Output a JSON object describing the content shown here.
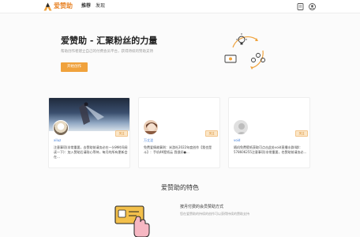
{
  "header": {
    "brand": "爱赞助",
    "nav": [
      "推荐",
      "发现"
    ],
    "icons": [
      "logo-icon",
      "notes-icon",
      "user-icon"
    ],
    "accent": "#f0a23c"
  },
  "hero": {
    "title": "爱赞助 - 汇聚粉丝的力量",
    "subtitle": "帮助创作者建立自己的付费会员平台，获得持续的赞助支持",
    "button": "开始创作"
  },
  "cards": [
    {
      "name": "xiluz",
      "follow": "关注",
      "desc": "注意事项(非常重要，去赞助前请务必在一分钟时间阅读一下)：加入赞助后请耐心等待，每月的所有更新会在…"
    },
    {
      "name": "万丈泷",
      "follow": "关注",
      "desc": "免费爱情故事则：米游社2022年度创作【我也是斗】：手机4K壁纸云 我很好●..."
    },
    {
      "name": "void",
      "follow": "关注",
      "desc": "随机免费壁纸获取可点击此处void直播水群4群：578606255注意事项(非常重要，也赞助前请务必..."
    }
  ],
  "features": {
    "title": "爱赞助的特色",
    "items": [
      {
        "heading": "按月付费的会员赞助方式",
        "desc": "您在爱赞助的持续的创作可以获得持续的赞助支持"
      }
    ]
  }
}
